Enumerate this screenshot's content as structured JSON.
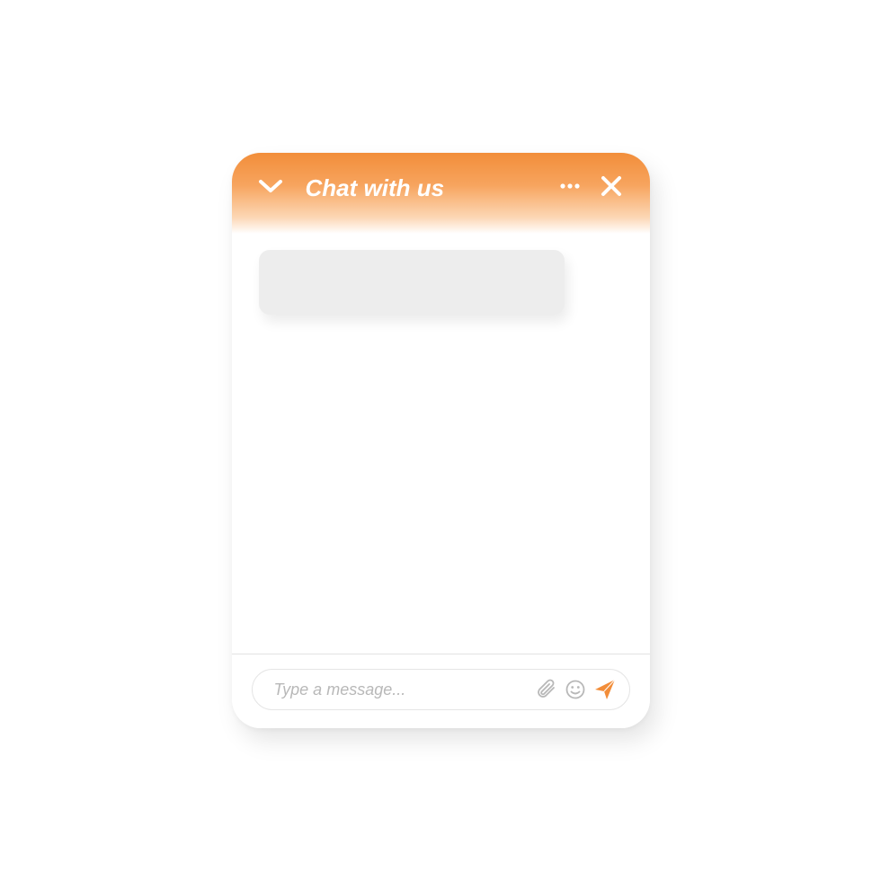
{
  "header": {
    "title": "Chat with us"
  },
  "input": {
    "placeholder": "Type a message..."
  },
  "colors": {
    "accent": "#f28d39",
    "iconGrey": "#b8b8b8"
  }
}
